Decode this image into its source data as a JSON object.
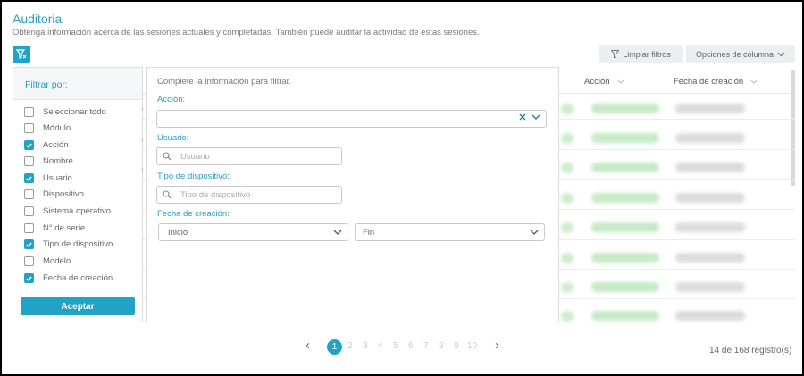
{
  "header": {
    "title": "Auditoria",
    "subtitle": "Obtenga información acerca de las sesiones actuales y completadas. También puede auditar la actividad de estas sesiones."
  },
  "toolbar": {
    "clear_filters": "Limpiar filtros",
    "column_options": "Opciones de columna"
  },
  "table": {
    "columns": [
      "Acción",
      "Fecha de creación"
    ]
  },
  "filter_by": {
    "title": "Filtrar por:",
    "items": [
      {
        "label": "Seleccionar todo",
        "checked": false
      },
      {
        "label": "Módulo",
        "checked": false
      },
      {
        "label": "Acción",
        "checked": true
      },
      {
        "label": "Nombre",
        "checked": false
      },
      {
        "label": "Usuario",
        "checked": true
      },
      {
        "label": "Dispositivo",
        "checked": false
      },
      {
        "label": "Sistema operativo",
        "checked": false
      },
      {
        "label": "N° de serie",
        "checked": false
      },
      {
        "label": "Tipo de dispositivo",
        "checked": true
      },
      {
        "label": "Modelo",
        "checked": false
      },
      {
        "label": "Fecha de creación",
        "checked": true
      }
    ],
    "accept": "Aceptar"
  },
  "form": {
    "intro": "Complete la información para filtrar.",
    "accion_label": "Acción:",
    "usuario_label": "Usuario:",
    "usuario_placeholder": "Usuario",
    "tipo_label": "Tipo de dispositivo:",
    "tipo_placeholder": "Tipo de dispositivo",
    "fecha_label": "Fecha de creación:",
    "inicio": "Inicio",
    "fin": "Fin"
  },
  "pagination": {
    "prev": "‹",
    "next": "›",
    "active": "1",
    "pages": [
      "2",
      "3",
      "4",
      "5",
      "6",
      "7",
      "8",
      "9",
      "10"
    ],
    "records": "14 de 168 registro(s)"
  },
  "colors": {
    "accent": "#22a2c4",
    "title": "#2a9fc0"
  }
}
